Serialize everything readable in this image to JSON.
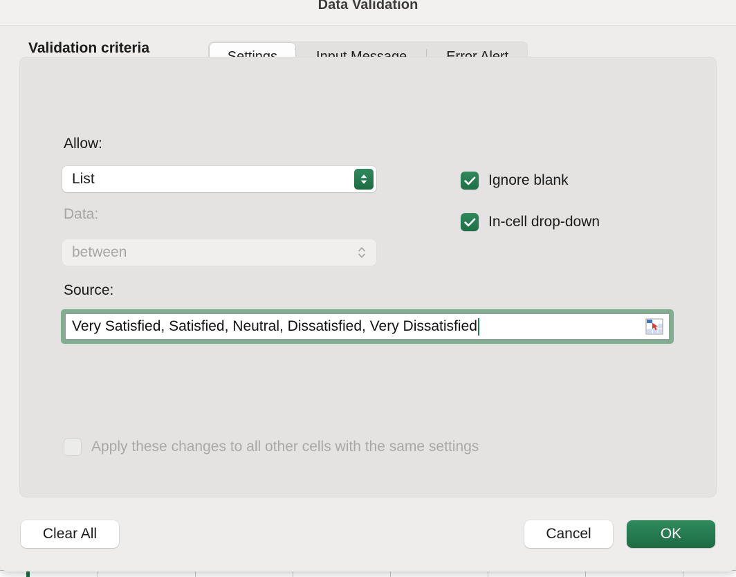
{
  "window": {
    "title": "Data Validation"
  },
  "tabs": [
    {
      "label": "Settings",
      "active": true
    },
    {
      "label": "Input Message",
      "active": false
    },
    {
      "label": "Error Alert",
      "active": false
    }
  ],
  "panel": {
    "heading": "Validation criteria",
    "allow": {
      "label": "Allow:",
      "value": "List",
      "enabled": true,
      "stepper_icon": "chevron-up-down-icon"
    },
    "data": {
      "label": "Data:",
      "value": "between",
      "enabled": false,
      "stepper_icon": "chevron-up-down-icon"
    },
    "source": {
      "label": "Source:",
      "value": "Very Satisfied, Satisfied, Neutral, Dissatisfied, Very Dissatisfied",
      "focused": true,
      "range_picker_icon": "select-range-icon"
    },
    "options": [
      {
        "label": "Ignore blank",
        "checked": true,
        "enabled": true
      },
      {
        "label": "In-cell drop-down",
        "checked": true,
        "enabled": true
      }
    ],
    "apply_all": {
      "label": "Apply these changes to all other cells with the same settings",
      "checked": false,
      "enabled": false
    }
  },
  "footer": {
    "clear_all": "Clear All",
    "cancel": "Cancel",
    "ok": "OK"
  },
  "colors": {
    "accent_green": "#1d6b43",
    "accent_green_light": "#2f8b5d",
    "focus_ring": "#7fae90",
    "dialog_background": "#eeedeb",
    "panel_background": "#e4e3e2",
    "text_primary": "#1b1b1b",
    "text_disabled": "#a8a7a6",
    "caret": "#1f7a4d"
  }
}
